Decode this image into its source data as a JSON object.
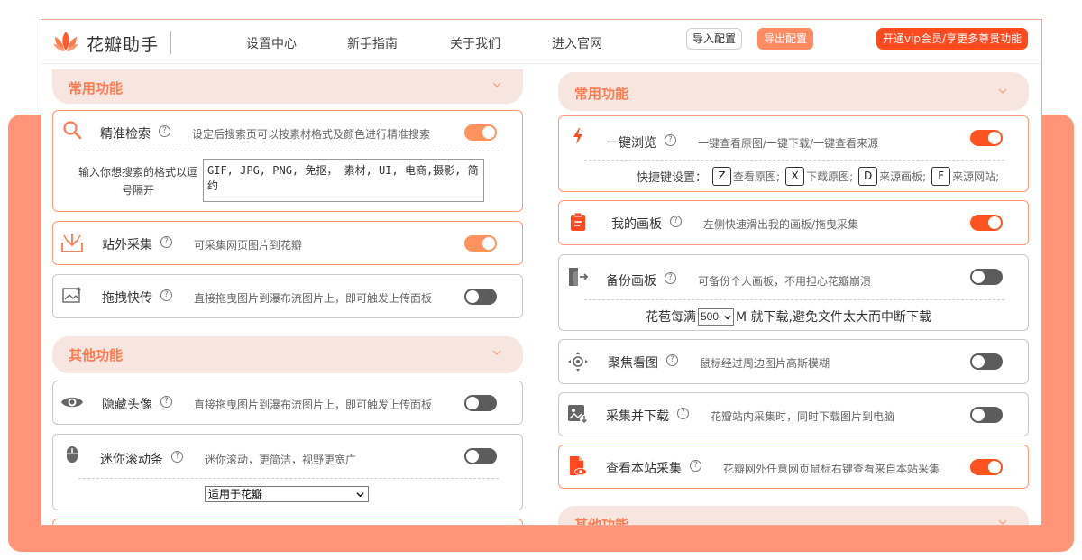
{
  "app": {
    "brand": "花瓣助手",
    "accent": "#ff7a4f"
  },
  "nav": [
    {
      "label": "设置中心"
    },
    {
      "label": "新手指南"
    },
    {
      "label": "关于我们"
    },
    {
      "label": "进入官网"
    }
  ],
  "header_buttons": {
    "import_label": "导入配置",
    "export_label": "导出配置",
    "vip_label": "开通vip会员/享更多尊贵功能"
  },
  "left": {
    "section1_title": "常用功能",
    "section2_title": "其他功能",
    "precise_search": {
      "title": "精准检索",
      "desc": "设定后搜索页可以按素材格式及颜色进行精准搜索",
      "enabled": true,
      "input_label": "输入你想搜索的格式以逗号隔开",
      "input_value": "GIF, JPG, PNG, 免抠， 素材, UI, 电商,摄影, 简约"
    },
    "external_collect": {
      "title": "站外采集",
      "desc": "可采集网页图片到花瓣",
      "enabled": true
    },
    "drag_upload": {
      "title": "拖拽快传",
      "desc": "直接拖曳图片到瀑布流图片上，即可触发上传面板",
      "enabled": false
    },
    "hide_avatar": {
      "title": "隐藏头像",
      "desc": "直接拖曳图片到瀑布流图片上，即可触发上传面板",
      "enabled": false
    },
    "mini_scroll": {
      "title": "迷你滚动条",
      "desc": "迷你滚动，更简洁，视野更宽广",
      "enabled": false,
      "select_value": "适用于花瓣"
    }
  },
  "right": {
    "section1_title": "常用功能",
    "section2_title": "其他功能",
    "one_click": {
      "title": "一键浏览",
      "desc": "一键查看原图/一键下载/一键查看来源",
      "enabled": true,
      "hotkey_label": "快捷键设置：",
      "hotkeys": [
        {
          "key": "Z",
          "label": "查看原图;"
        },
        {
          "key": "X",
          "label": "下载原图;"
        },
        {
          "key": "D",
          "label": "来源画板;"
        },
        {
          "key": "F",
          "label": "来源网站;"
        }
      ]
    },
    "my_board": {
      "title": "我的画板",
      "desc": "左侧快速滑出我的画板/拖曳采集",
      "enabled": true
    },
    "backup_board": {
      "title": "备份画板",
      "desc": "可备份个人画板，不用担心花瓣崩溃",
      "enabled": false,
      "row_prefix": "花苞每满",
      "row_value": "500",
      "row_suffix": "M 就下载,避免文件太大而中断下载"
    },
    "focus_view": {
      "title": "聚焦看图",
      "desc": "鼠标经过周边图片高斯模糊",
      "enabled": false
    },
    "collect_download": {
      "title": "采集并下载",
      "desc": "花瓣站内采集时，同时下载图片到电脑",
      "enabled": false
    },
    "view_site_collect": {
      "title": "查看本站采集",
      "desc": "花瓣网外任意网页鼠标右键查看来自本站采集",
      "enabled": true
    }
  }
}
